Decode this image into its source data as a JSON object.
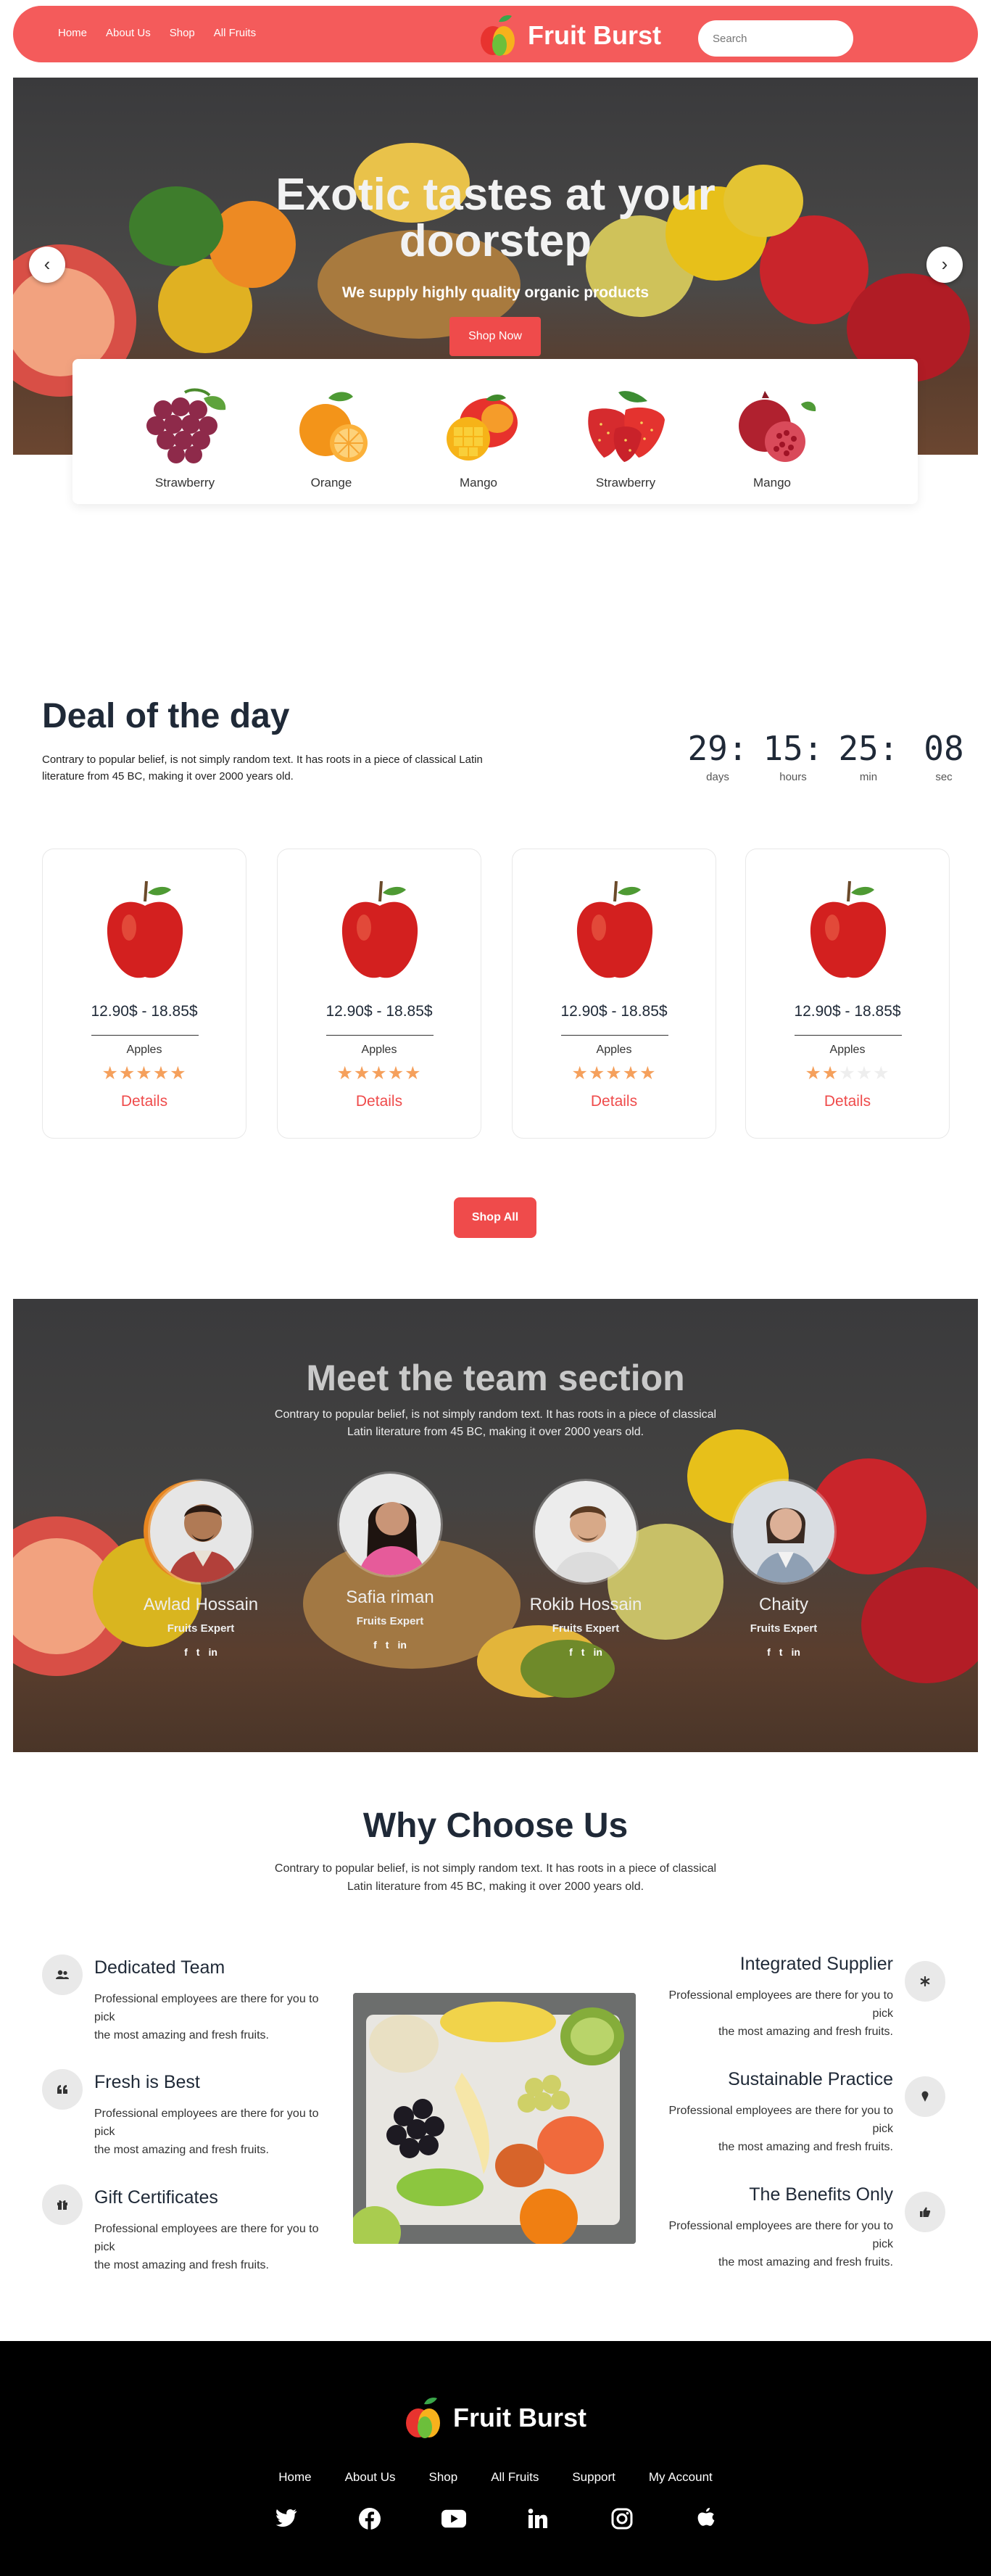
{
  "nav": {
    "links": [
      "Home",
      "About Us",
      "Shop",
      "All Fruits"
    ],
    "brand": "Fruit Burst",
    "search_placeholder": "Search"
  },
  "hero": {
    "title_line1": "Exotic tastes at your",
    "title_line2": "doorstep",
    "subtitle": "We supply highly quality organic products",
    "button": "Shop Now",
    "prev_arrow": "‹",
    "next_arrow": "›"
  },
  "fruit_strip": [
    {
      "label": "Strawberry",
      "icon": "grapes-icon"
    },
    {
      "label": "Orange",
      "icon": "orange-icon"
    },
    {
      "label": "Mango",
      "icon": "mango-icon"
    },
    {
      "label": "Strawberry",
      "icon": "strawberry-icon"
    },
    {
      "label": "Mango",
      "icon": "pomegranate-icon"
    }
  ],
  "deal": {
    "title": "Deal of the day",
    "description": "Contrary to popular belief, is not simply random text. It has roots in a piece of classical Latin literature from 45 BC, making it over 2000 years old.",
    "timer": [
      {
        "value": "29:",
        "unit": "days"
      },
      {
        "value": "15:",
        "unit": "hours"
      },
      {
        "value": "25:",
        "unit": "min"
      },
      {
        "value": "08",
        "unit": "sec"
      }
    ],
    "cards": [
      {
        "price": "12.90$ - 18.85$",
        "name": "Apples",
        "rating": 5,
        "details": "Details"
      },
      {
        "price": "12.90$ - 18.85$",
        "name": "Apples",
        "rating": 5,
        "details": "Details"
      },
      {
        "price": "12.90$ - 18.85$",
        "name": "Apples",
        "rating": 5,
        "details": "Details"
      },
      {
        "price": "12.90$ - 18.85$",
        "name": "Apples",
        "rating": 2,
        "details": "Details"
      }
    ],
    "shop_all": "Shop All"
  },
  "team": {
    "title": "Meet the team section",
    "description_line1": "Contrary to popular belief, is not simply random text. It has roots in a piece of classical",
    "description_line2": "Latin literature from 45 BC, making it over 2000 years old.",
    "members": [
      {
        "name": "Awlad Hossain",
        "role": "Fruits Expert"
      },
      {
        "name": "Safia riman",
        "role": "Fruits Expert"
      },
      {
        "name": "Rokib Hossain",
        "role": "Fruits Expert"
      },
      {
        "name": "Chaity",
        "role": "Fruits Expert"
      }
    ],
    "social": [
      "f",
      "t",
      "in"
    ]
  },
  "why": {
    "title": "Why Choose Us",
    "description_line1": "Contrary to popular belief, is not simply random text. It has roots in a piece of classical",
    "description_line2": "Latin literature from 45 BC, making it over 2000 years old.",
    "features_left": [
      {
        "title": "Dedicated Team",
        "text1": "Professional employees are there for you to pick",
        "text2": "the most amazing and fresh fruits.",
        "icon": "team-icon"
      },
      {
        "title": "Fresh is Best",
        "text1": "Professional employees are there for you to pick",
        "text2": "the most amazing and fresh fruits.",
        "icon": "quote-icon"
      },
      {
        "title": "Gift Certificates",
        "text1": "Professional employees are there for you to pick",
        "text2": "the most amazing and fresh fruits.",
        "icon": "gift-icon"
      }
    ],
    "features_right": [
      {
        "title": "Integrated Supplier",
        "text1": "Professional employees are there for you to pick",
        "text2": "the most amazing and fresh fruits.",
        "icon": "asterisk-icon"
      },
      {
        "title": "Sustainable Practice",
        "text1": "Professional employees are there for you to pick",
        "text2": "the most amazing and fresh fruits.",
        "icon": "ice-cream-icon"
      },
      {
        "title": "The Benefits Only",
        "text1": "Professional employees are there for you to pick",
        "text2": "the most amazing and fresh fruits.",
        "icon": "thumbs-up-icon"
      }
    ]
  },
  "footer": {
    "brand": "Fruit Burst",
    "links": [
      "Home",
      "About Us",
      "Shop",
      "All Fruits",
      "Support",
      "My Account"
    ],
    "social": [
      "twitter-icon",
      "facebook-icon",
      "youtube-icon",
      "linkedin-icon",
      "instagram-icon",
      "apple-icon"
    ]
  },
  "colors": {
    "accent": "#f45b5b",
    "button": "#ef4b4b",
    "star": "#f5a05c",
    "footer_bg": "#000000"
  }
}
